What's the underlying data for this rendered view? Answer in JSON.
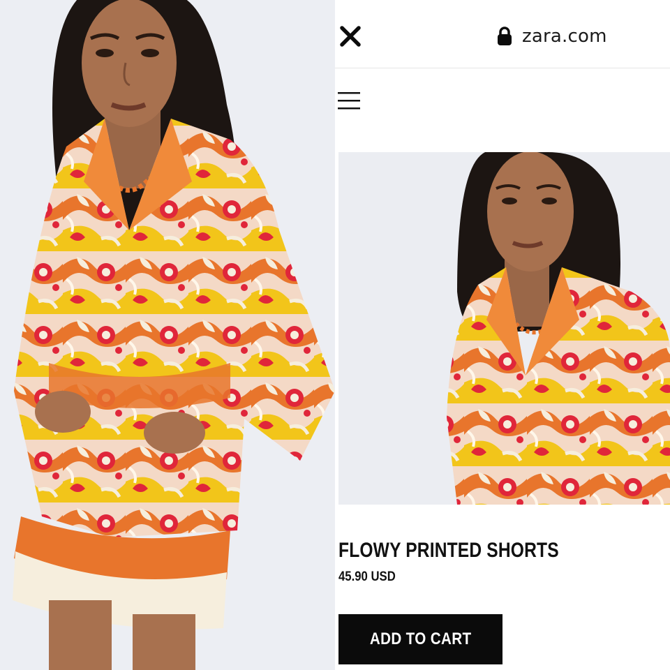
{
  "browser": {
    "url": "zara.com",
    "icons": {
      "close": "close-icon",
      "lock": "lock-icon",
      "menu": "hamburger-menu-icon"
    }
  },
  "product": {
    "title": "FLOWY PRINTED SHORTS",
    "price": "45.90 USD",
    "add_to_cart_label": "ADD TO CART"
  },
  "colors": {
    "button_bg": "#0b0b0b",
    "print_orange": "#e8752c",
    "print_red": "#e0263a",
    "print_yellow": "#f2c51a",
    "print_cream": "#f6eedd"
  }
}
